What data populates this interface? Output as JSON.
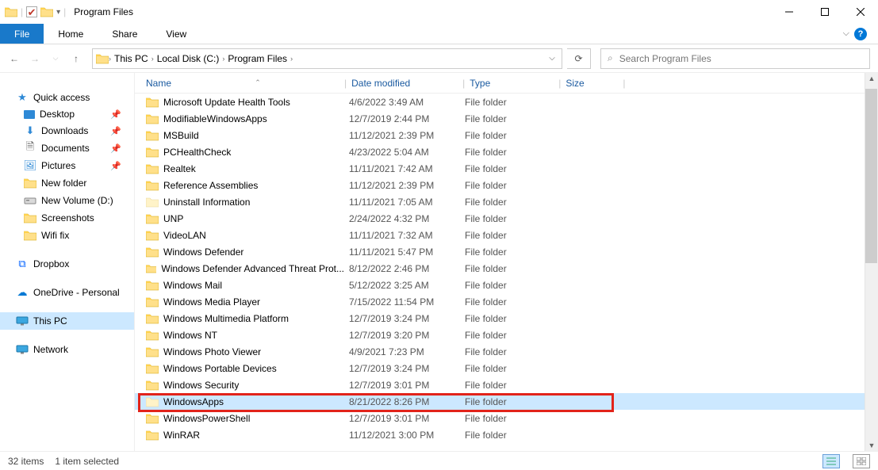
{
  "window": {
    "title": "Program Files"
  },
  "ribbon": {
    "file": "File",
    "tabs": [
      "Home",
      "Share",
      "View"
    ]
  },
  "breadcrumbs": [
    "This PC",
    "Local Disk (C:)",
    "Program Files"
  ],
  "search": {
    "placeholder": "Search Program Files"
  },
  "columns": {
    "name": "Name",
    "date": "Date modified",
    "type": "Type",
    "size": "Size"
  },
  "nav": {
    "quick_access": "Quick access",
    "quick_items": [
      {
        "label": "Desktop",
        "icon": "desktop",
        "pin": true
      },
      {
        "label": "Downloads",
        "icon": "downloads",
        "pin": true
      },
      {
        "label": "Documents",
        "icon": "documents",
        "pin": true
      },
      {
        "label": "Pictures",
        "icon": "pictures",
        "pin": true
      },
      {
        "label": "New folder",
        "icon": "folder",
        "pin": false
      },
      {
        "label": "New Volume (D:)",
        "icon": "drive",
        "pin": false
      },
      {
        "label": "Screenshots",
        "icon": "folder",
        "pin": false
      },
      {
        "label": "Wifi fix",
        "icon": "folder",
        "pin": false
      }
    ],
    "dropbox": "Dropbox",
    "onedrive": "OneDrive - Personal",
    "thispc": "This PC",
    "network": "Network"
  },
  "rows": [
    {
      "name": "Microsoft Update Health Tools",
      "date": "4/6/2022 3:49 AM",
      "type": "File folder",
      "dim": false
    },
    {
      "name": "ModifiableWindowsApps",
      "date": "12/7/2019 2:44 PM",
      "type": "File folder",
      "dim": false
    },
    {
      "name": "MSBuild",
      "date": "11/12/2021 2:39 PM",
      "type": "File folder",
      "dim": false
    },
    {
      "name": "PCHealthCheck",
      "date": "4/23/2022 5:04 AM",
      "type": "File folder",
      "dim": false
    },
    {
      "name": "Realtek",
      "date": "11/11/2021 7:42 AM",
      "type": "File folder",
      "dim": false
    },
    {
      "name": "Reference Assemblies",
      "date": "11/12/2021 2:39 PM",
      "type": "File folder",
      "dim": false
    },
    {
      "name": "Uninstall Information",
      "date": "11/11/2021 7:05 AM",
      "type": "File folder",
      "dim": true
    },
    {
      "name": "UNP",
      "date": "2/24/2022 4:32 PM",
      "type": "File folder",
      "dim": false
    },
    {
      "name": "VideoLAN",
      "date": "11/11/2021 7:32 AM",
      "type": "File folder",
      "dim": false
    },
    {
      "name": "Windows Defender",
      "date": "11/11/2021 5:47 PM",
      "type": "File folder",
      "dim": false
    },
    {
      "name": "Windows Defender Advanced Threat Prot...",
      "date": "8/12/2022 2:46 PM",
      "type": "File folder",
      "dim": false
    },
    {
      "name": "Windows Mail",
      "date": "5/12/2022 3:25 AM",
      "type": "File folder",
      "dim": false
    },
    {
      "name": "Windows Media Player",
      "date": "7/15/2022 11:54 PM",
      "type": "File folder",
      "dim": false
    },
    {
      "name": "Windows Multimedia Platform",
      "date": "12/7/2019 3:24 PM",
      "type": "File folder",
      "dim": false
    },
    {
      "name": "Windows NT",
      "date": "12/7/2019 3:20 PM",
      "type": "File folder",
      "dim": false
    },
    {
      "name": "Windows Photo Viewer",
      "date": "4/9/2021 7:23 PM",
      "type": "File folder",
      "dim": false
    },
    {
      "name": "Windows Portable Devices",
      "date": "12/7/2019 3:24 PM",
      "type": "File folder",
      "dim": false
    },
    {
      "name": "Windows Security",
      "date": "12/7/2019 3:01 PM",
      "type": "File folder",
      "dim": false
    },
    {
      "name": "WindowsApps",
      "date": "8/21/2022 8:26 PM",
      "type": "File folder",
      "dim": true,
      "selected": true
    },
    {
      "name": "WindowsPowerShell",
      "date": "12/7/2019 3:01 PM",
      "type": "File folder",
      "dim": false
    },
    {
      "name": "WinRAR",
      "date": "11/12/2021 3:00 PM",
      "type": "File folder",
      "dim": false
    }
  ],
  "status": {
    "items": "32 items",
    "selection": "1 item selected"
  },
  "icons": {
    "star": "★",
    "back": "←",
    "fwd": "→",
    "up": "↑",
    "refresh": "⟳",
    "search": "🔍",
    "pin": "📌"
  }
}
